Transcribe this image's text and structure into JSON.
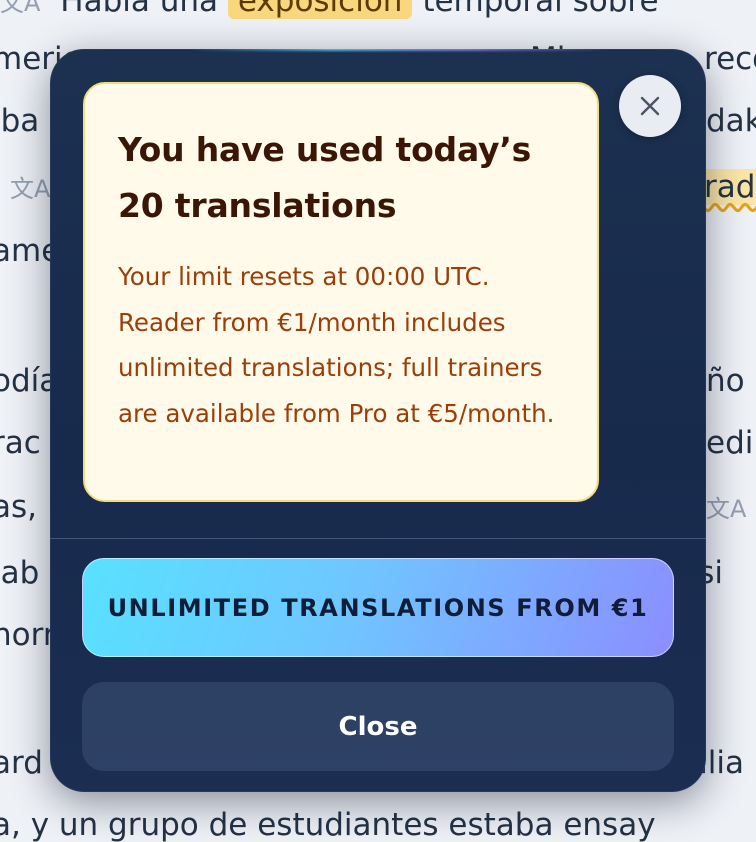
{
  "background_text": {
    "line_a_prefix": "Había una",
    "line_a_highlight": "exposición",
    "line_a_suffix": "temporal sobre",
    "line_b": "merio",
    "line_b_right": "Mi",
    "line_b_right2": "reco",
    "line_c": "lba",
    "line_c_right": "dak",
    "line_d_right": "rada",
    "line_e": "ame",
    "line_f": "odía",
    "line_f_right": "ño d",
    "line_g": "rac",
    "line_g_right": "edi",
    "line_h": "as,",
    "line_h_right": "I",
    "line_i": "lab",
    "line_i_right": "y si",
    "line_j": "norr",
    "line_k": "ard",
    "line_k_right": "amilia",
    "line_l": "a, y un grupo de estudiantes estaba ensay"
  },
  "icons": {
    "translate": "translate-icon",
    "close": "close-icon"
  },
  "modal": {
    "notice": {
      "title": "You have used today’s 20 translations",
      "body": "Your limit resets at 00:00 UTC. Reader from €1/month includes unlimited translations; full trainers are available from Pro at €5/month."
    },
    "cta_label": "UNLIMITED TRANSLATIONS FROM €1",
    "close_label": "Close"
  },
  "colors": {
    "modal_bg": "#172a4c",
    "notice_bg": "#fffaea",
    "notice_border": "#f3dc79",
    "title_color": "#3b1605",
    "body_color": "#9a3f0a",
    "cta_gradient_start": "#58e1ff",
    "cta_gradient_end": "#8b8eff"
  }
}
